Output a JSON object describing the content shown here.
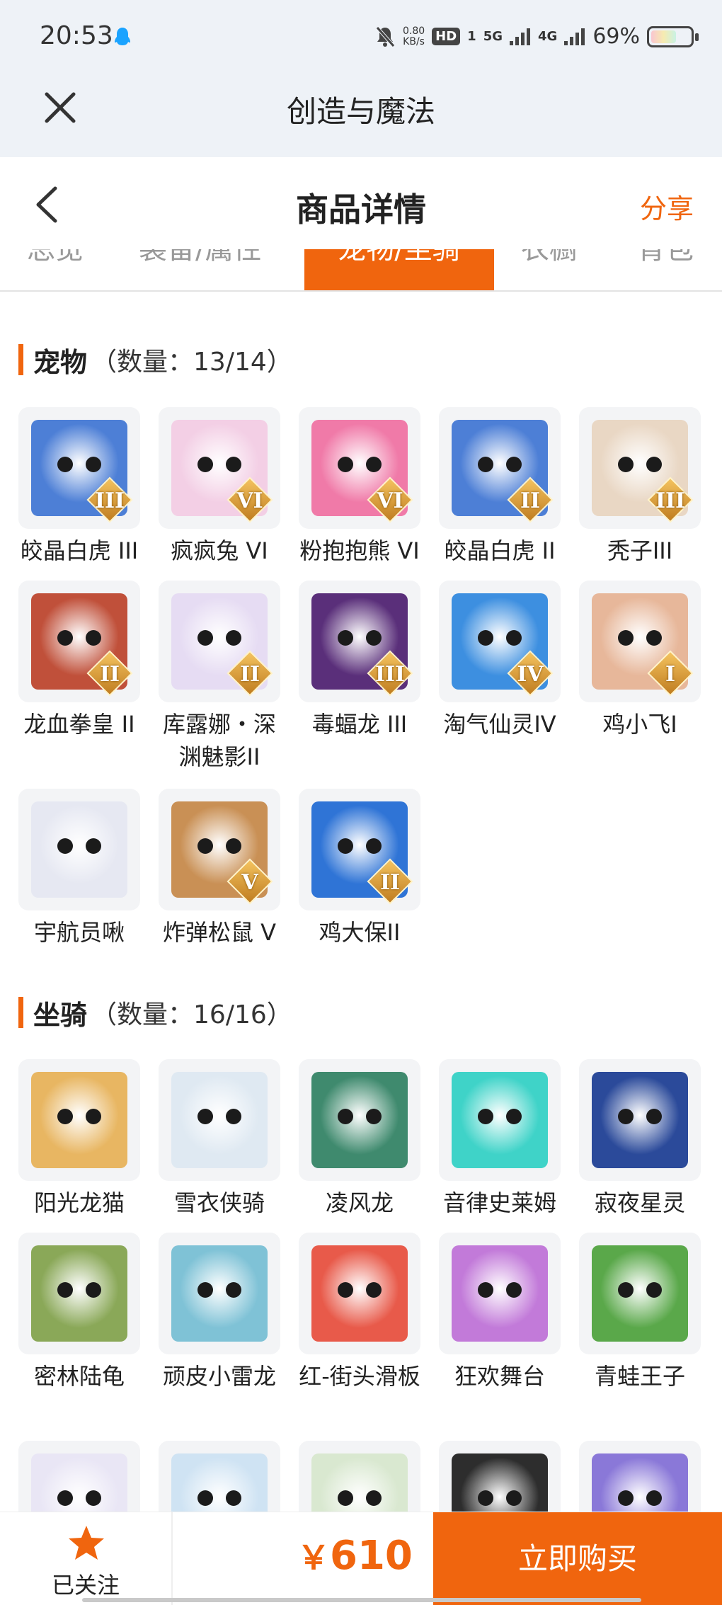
{
  "status_bar": {
    "time": "20:53",
    "net_speed_value": "0.80",
    "net_speed_unit": "KB/s",
    "hd": "HD",
    "sim1": "1",
    "signal_5g": "5G",
    "signal_4g": "4G",
    "battery": "69%",
    "battery_level": 0.69
  },
  "app_bar": {
    "title": "创造与魔法"
  },
  "header": {
    "title": "商品详情",
    "share": "分享"
  },
  "tabs": [
    {
      "label": "总览"
    },
    {
      "label": "装备/属性"
    },
    {
      "label": "宠物/坐骑",
      "active": true
    },
    {
      "label": "衣橱"
    },
    {
      "label": "背包"
    }
  ],
  "pets": {
    "title": "宠物",
    "count": "（数量：13/14）",
    "items": [
      {
        "name": "皎晶白虎 III",
        "badge": "III",
        "color": "#4d7fd6"
      },
      {
        "name": "疯疯兔 VI",
        "badge": "VI",
        "color": "#f3cfe5"
      },
      {
        "name": "粉抱抱熊 VI",
        "badge": "VI",
        "color": "#f07aa8"
      },
      {
        "name": "皎晶白虎 II",
        "badge": "II",
        "color": "#4d7fd6"
      },
      {
        "name": "秃子III",
        "badge": "III",
        "color": "#e9d7c4"
      },
      {
        "name": "龙血拳皇 II",
        "badge": "II",
        "color": "#c0503a"
      },
      {
        "name": "库露娜・深渊魅影II",
        "badge": "II",
        "color": "#e6dcf3"
      },
      {
        "name": "毒蝠龙 III",
        "badge": "III",
        "color": "#5a2f7a"
      },
      {
        "name": "淘气仙灵IV",
        "badge": "IV",
        "color": "#3d8fe0"
      },
      {
        "name": "鸡小飞I",
        "badge": "I",
        "color": "#e7b79a"
      },
      {
        "name": "宇航员啾",
        "badge": "",
        "color": "#e6e8f2"
      },
      {
        "name": "炸弹松鼠 V",
        "badge": "V",
        "color": "#c99055"
      },
      {
        "name": "鸡大保II",
        "badge": "II",
        "color": "#2f74d6"
      }
    ]
  },
  "mounts": {
    "title": "坐骑",
    "count": "（数量：16/16）",
    "items": [
      {
        "name": "阳光龙猫",
        "color": "#e8b662"
      },
      {
        "name": "雪衣侠骑",
        "color": "#dfe9f2"
      },
      {
        "name": "凌风龙",
        "color": "#3f8a6e"
      },
      {
        "name": "音律史莱姆",
        "color": "#3fd3c8"
      },
      {
        "name": "寂夜星灵",
        "color": "#2b4a9a"
      },
      {
        "name": "密林陆龟",
        "color": "#8aa858"
      },
      {
        "name": "顽皮小雷龙",
        "color": "#7fc2d6"
      },
      {
        "name": "红-街头滑板",
        "color": "#e85a4a"
      },
      {
        "name": "狂欢舞台",
        "color": "#c27ad9"
      },
      {
        "name": "青蛙王子",
        "color": "#5aa84a"
      },
      {
        "name": "",
        "color": "#e9e6f5"
      },
      {
        "name": "",
        "color": "#cfe3f3"
      },
      {
        "name": "",
        "color": "#d9e8d0"
      },
      {
        "name": "",
        "color": "#2d2d2d"
      },
      {
        "name": "",
        "color": "#8a78d8"
      }
    ]
  },
  "bottom_bar": {
    "follow_label": "已关注",
    "currency": "￥",
    "price": "610",
    "buy_label": "立即购买",
    "accent": "#f0650e"
  }
}
